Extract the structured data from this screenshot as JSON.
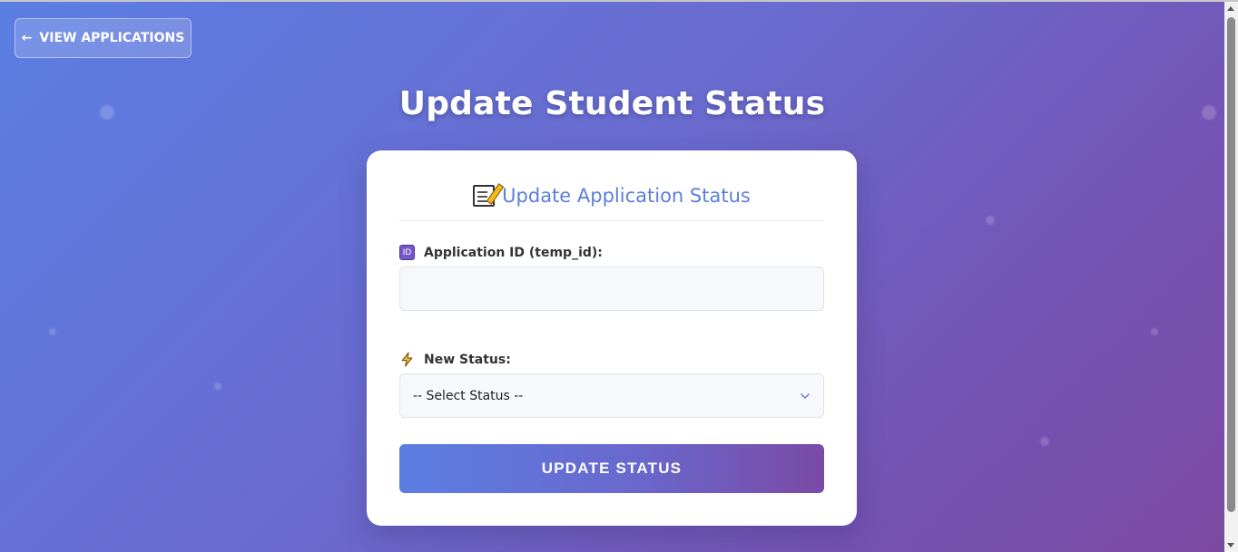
{
  "nav": {
    "back_label": "VIEW APPLICATIONS",
    "back_icon": "←"
  },
  "page": {
    "title": "Update Student Status"
  },
  "card": {
    "title": "Update Application Status",
    "title_icon": "memo-icon",
    "accent_color": "#5b7fdc"
  },
  "form": {
    "app_id": {
      "label": "Application ID (temp_id):",
      "icon_text": "ID",
      "value": "",
      "placeholder": ""
    },
    "status": {
      "label": "New Status:",
      "selected": "-- Select Status --"
    },
    "submit_label": "UPDATE STATUS"
  },
  "colors": {
    "gradient_start": "#5b7ee3",
    "gradient_end": "#7d4aa2"
  }
}
